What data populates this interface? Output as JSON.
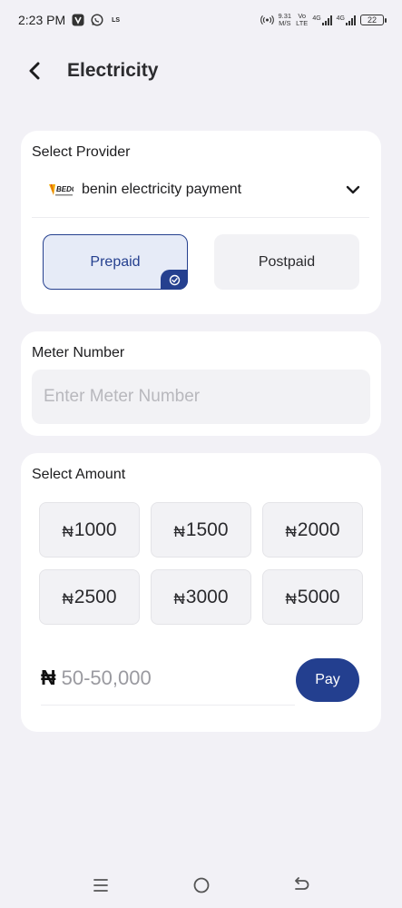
{
  "status_bar": {
    "time": "2:23 PM",
    "net_speed_value": "9.31",
    "net_speed_unit": "M/S",
    "volte_top": "Vo",
    "volte_bottom": "LTE",
    "sig1_label": "4G",
    "sig2_label": "4G",
    "battery": "22",
    "notif_ls": "LS"
  },
  "header": {
    "title": "Electricity"
  },
  "provider_card": {
    "label": "Select Provider",
    "selected_provider": "benin electricity payment",
    "logo_text": "BEDC",
    "types": [
      {
        "label": "Prepaid",
        "selected": true
      },
      {
        "label": "Postpaid",
        "selected": false
      }
    ]
  },
  "meter_card": {
    "label": "Meter Number",
    "placeholder": "Enter Meter Number"
  },
  "amount_card": {
    "label": "Select Amount",
    "currency_symbol": "₦",
    "presets": [
      "1000",
      "1500",
      "2000",
      "2500",
      "3000",
      "5000"
    ],
    "custom_placeholder": "50-50,000",
    "pay_label": "Pay"
  },
  "colors": {
    "accent": "#233f8f",
    "accent_light": "#e6ebf7",
    "background": "#f2f1f6"
  }
}
